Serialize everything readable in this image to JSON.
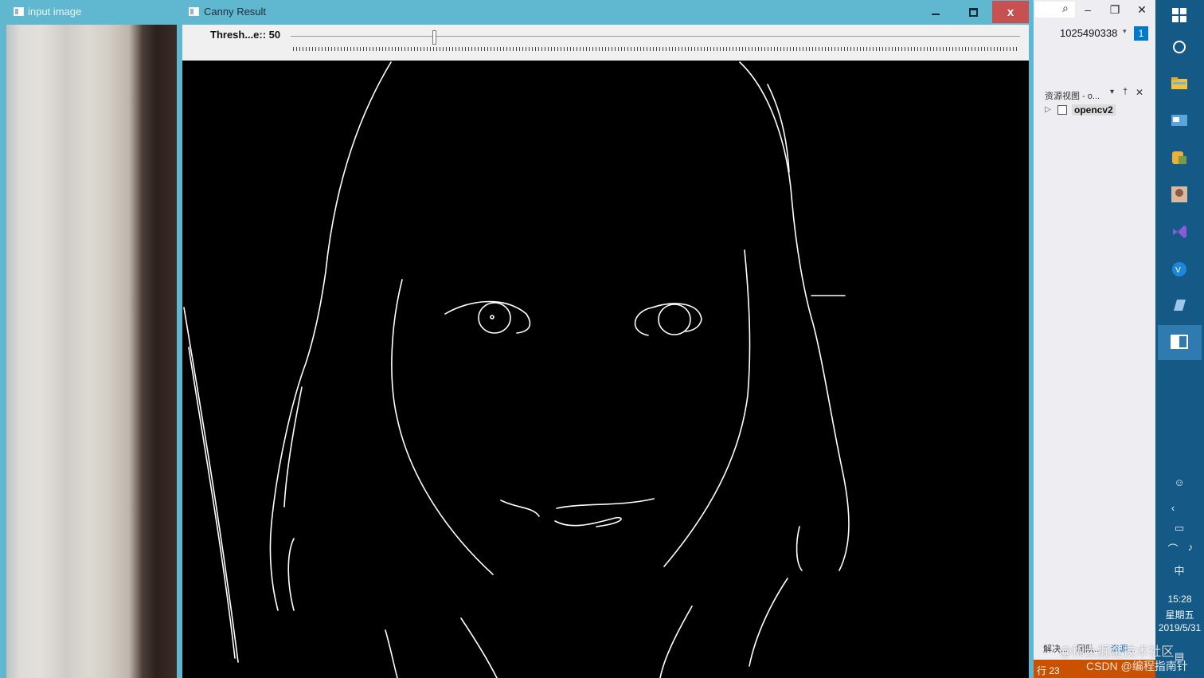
{
  "input_window": {
    "title": "input image"
  },
  "canny_window": {
    "title": "Canny Result",
    "caption_buttons": {
      "close": "x"
    },
    "trackbar": {
      "label": "Thresh...e:: 50",
      "value": 50,
      "max": 255
    }
  },
  "ide": {
    "account": "1025490338",
    "notification_count": "1",
    "resource_view": {
      "title": "资源视图 - o...",
      "tree": [
        {
          "label": "opencv2"
        }
      ]
    },
    "bottom_tabs": [
      "解决...",
      "团队...",
      "资源..."
    ],
    "status": "行 23"
  },
  "taskbar": {
    "time": "15:28",
    "weekday": "星期五",
    "date": "2019/5/31",
    "ime": "中"
  },
  "watermark": {
    "line1": "@稀土掘金技术社区",
    "line2": "CSDN @编程指南针"
  },
  "colors": {
    "window_frame": "#60b7d0",
    "close_button": "#c75050",
    "taskbar": "#155a87",
    "vs_status": "#ca5100",
    "vs_accent": "#007acc"
  }
}
